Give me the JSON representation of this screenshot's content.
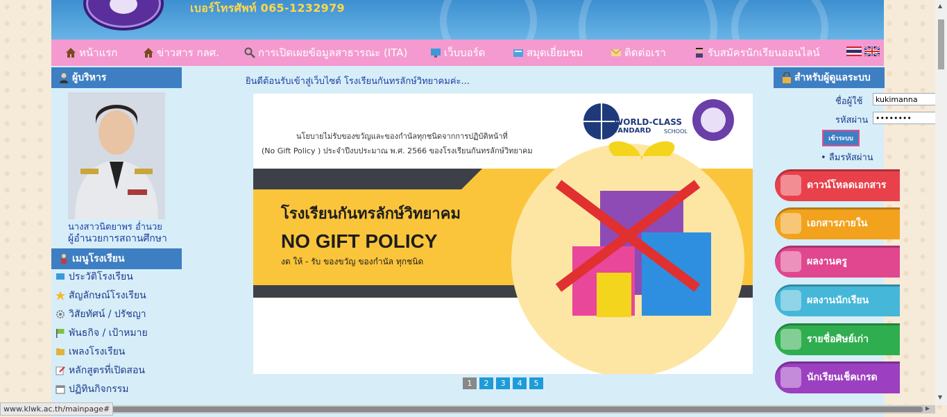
{
  "header": {
    "phone": "เบอร์โทรศัพท์ 065-1232979"
  },
  "nav": [
    {
      "label": "หน้าแรก",
      "icon": "home-icon"
    },
    {
      "label": "ข่าวสาร กลศ.",
      "icon": "home-icon"
    },
    {
      "label": "การเปิดเผยข้อมูลสาธารณะ (ITA)",
      "icon": "search-icon"
    },
    {
      "label": "เว็บบอร์ด",
      "icon": "monitor-icon"
    },
    {
      "label": "สมุดเยี่ยมชม",
      "icon": "book-icon"
    },
    {
      "label": "ติดต่อเรา",
      "icon": "mail-icon"
    },
    {
      "label": "รับสมัครนักเรียนออนไลน์",
      "icon": "student-icon"
    }
  ],
  "left": {
    "admin_title": "ผู้บริหาร",
    "admin_name": "นางสาวนิตยาพร อ่ำนวย",
    "admin_role": "ผู้อำนวยการสถานศึกษา",
    "menu_title": "เมนูโรงเรียน",
    "menu": [
      "ประวัติโรงเรียน",
      "สัญลักษณ์โรงเรียน",
      "วิสัยทัศน์ / ปรัชญา",
      "พันธกิจ / เป้าหมาย",
      "เพลงโรงเรียน",
      "หลักสูตรที่เปิดสอน",
      "ปฏิทินกิจกรรม"
    ]
  },
  "center": {
    "welcome": "ยินดีต้อนรับเข้าสู่เว็บไซต์ โรงเรียนกันทรลักษ์วิทยาคมค่ะ...",
    "banner": {
      "policy_line1": "นโยบายไม่รับของขวัญและของกำนัลทุกชนิดจากการปฏิบัติหน้าที่",
      "policy_line2": "(No Gift Policy ) ประจำปีงบประมาณ พ.ศ. 2566 ของโรงเรียนกันทรลักษ์วิทยาคม",
      "school": "โรงเรียนกันทรลักษ์วิทยาคม",
      "headline": "NO GIFT POLICY",
      "sub": "งด ให้ - รับ ของขวัญ ของกำนัล ทุกชนิด",
      "wc1": "WORLD-CLASS",
      "wc2": "STANDARD",
      "wc3": "SCHOOL"
    },
    "pages": [
      "1",
      "2",
      "3",
      "4",
      "5"
    ],
    "current_page": "1"
  },
  "login": {
    "title": "สำหรับผู้ดูแลระบบ",
    "user_label": "ชื่อผู้ใช้",
    "user_value": "kukimanna",
    "pass_label": "รหัสผ่าน",
    "pass_value": "••••••••",
    "button": "เข้าระบบ",
    "forgot": "• ลืมรหัสผ่าน"
  },
  "side_buttons": [
    {
      "label": "ดาวน์โหลดเอกสาร",
      "color": "#e8414b"
    },
    {
      "label": "เอกสารภายใน",
      "color": "#f2a21d"
    },
    {
      "label": "ผลงานครู",
      "color": "#e0478f"
    },
    {
      "label": "ผลงานนักเรียน",
      "color": "#45b7d8"
    },
    {
      "label": "รายชื่อศิษย์เก่า",
      "color": "#2fae4f"
    },
    {
      "label": "นักเรียนเช็คเกรด",
      "color": "#9c3fc0"
    }
  ],
  "status_url": "www.klwk.ac.th/mainpage#"
}
